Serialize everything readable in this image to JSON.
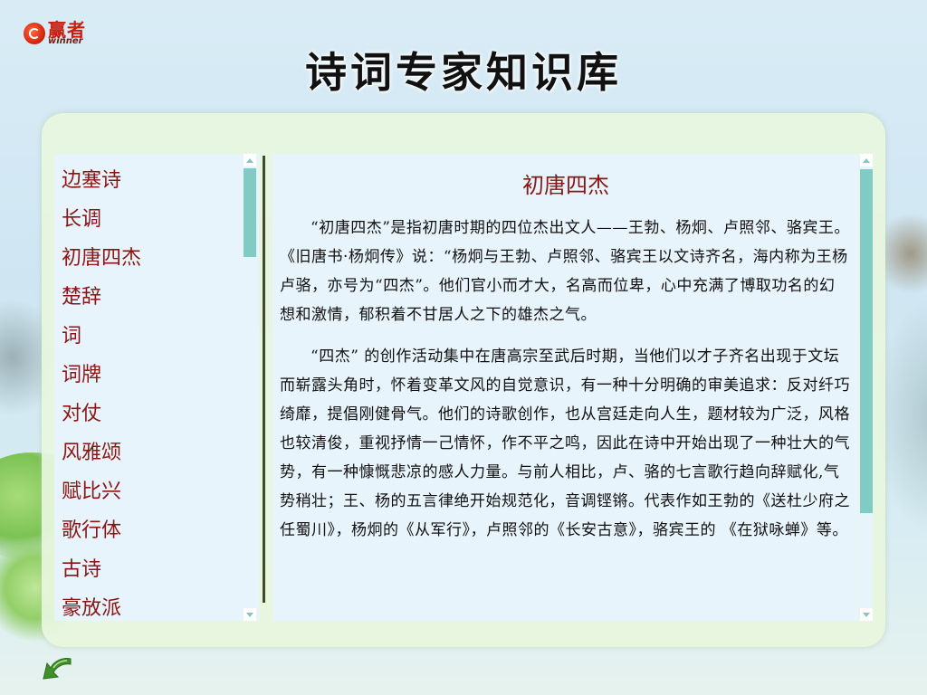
{
  "logo": {
    "cn": "赢者",
    "en": "winner"
  },
  "title": "诗词专家知识库",
  "nav": {
    "items": [
      "边塞诗",
      "长调",
      "初唐四杰",
      "楚辞",
      "词",
      "词牌",
      "对仗",
      "风雅颂",
      "赋比兴",
      "歌行体",
      "古诗",
      "豪放派"
    ]
  },
  "article": {
    "title": "初唐四杰",
    "paragraphs": [
      "“初唐四杰”是指初唐时期的四位杰出文人——王勃、杨炯、卢照邻、骆宾王。《旧唐书·杨炯传》说：“杨炯与王勃、卢照邻、骆宾王以文诗齐名，海内称为王杨卢骆，亦号为“四杰”。他们官小而才大，名高而位卑，心中充满了博取功名的幻想和激情，郁积着不甘居人之下的雄杰之气。",
      "“四杰” 的创作活动集中在唐高宗至武后时期，当他们以才子齐名出现于文坛而崭露头角时，怀着变革文风的自觉意识，有一种十分明确的审美追求：反对纤巧绮靡，提倡刚健骨气。他们的诗歌创作，也从宫廷走向人生，题材较为广泛，风格也较清俊，重视抒情一己情怀，作不平之鸣，因此在诗中开始出现了一种壮大的气势，有一种慷慨悲凉的感人力量。与前人相比，卢、骆的七言歌行趋向辞赋化,气势稍壮；王、杨的五言律绝开始规范化，音调铿锵。代表作如王勃的《送杜少府之任蜀川》，杨炯的《从军行》，卢照邻的《长安古意》，骆宾王的 《在狱咏蝉》等。"
    ]
  },
  "colors": {
    "accent": "#8b1414",
    "scroll_thumb": "#80cbc4",
    "panel": "#e8f6de"
  },
  "icons": {
    "back": "back-arrow-icon",
    "scroll_up": "scroll-up-icon",
    "scroll_down": "scroll-down-icon"
  }
}
